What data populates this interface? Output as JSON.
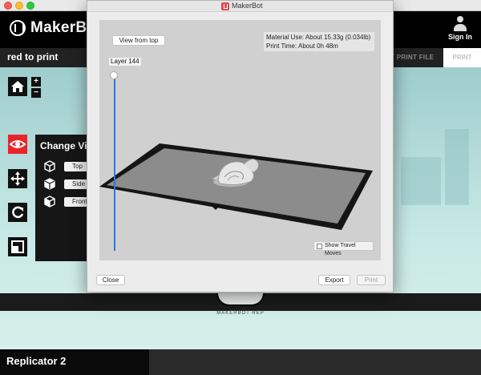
{
  "background_app": {
    "logo_text": "MakerBot",
    "signin_label": "Sign In",
    "sub_status": "red to print",
    "export_file_label": "T PRINT FILE",
    "print_tab": "PRINT",
    "change_view_title": "Change Vie",
    "view_buttons": [
      "Top",
      "Side",
      "Front"
    ],
    "printer_name": "Replicator 2",
    "dome_text": "MAKERBOT REP"
  },
  "dialog": {
    "title": "MakerBot",
    "view_from_top_label": "View from top",
    "material_use": "Material Use: About 15.33g (0.034lb)",
    "print_time": "Print Time: About 0h 48m",
    "layer_label": "Layer 144",
    "show_travel_moves_label": "Show Travel Moves",
    "show_travel_moves_checked": false,
    "close_label": "Close",
    "export_label": "Export",
    "print_label": "Print",
    "print_enabled": false
  },
  "icons": {
    "home": "home-icon",
    "zoom_in": "plus-icon",
    "zoom_out": "minus-icon",
    "view": "eye-icon",
    "move": "move-arrows-icon",
    "rotate": "rotate-icon",
    "scale": "scale-icon",
    "cube": "cube-icon"
  },
  "colors": {
    "accent_red": "#e8242a",
    "slider_blue": "#2f78e0",
    "header_black": "#000000",
    "stage_teal": "#bfe3e1"
  }
}
